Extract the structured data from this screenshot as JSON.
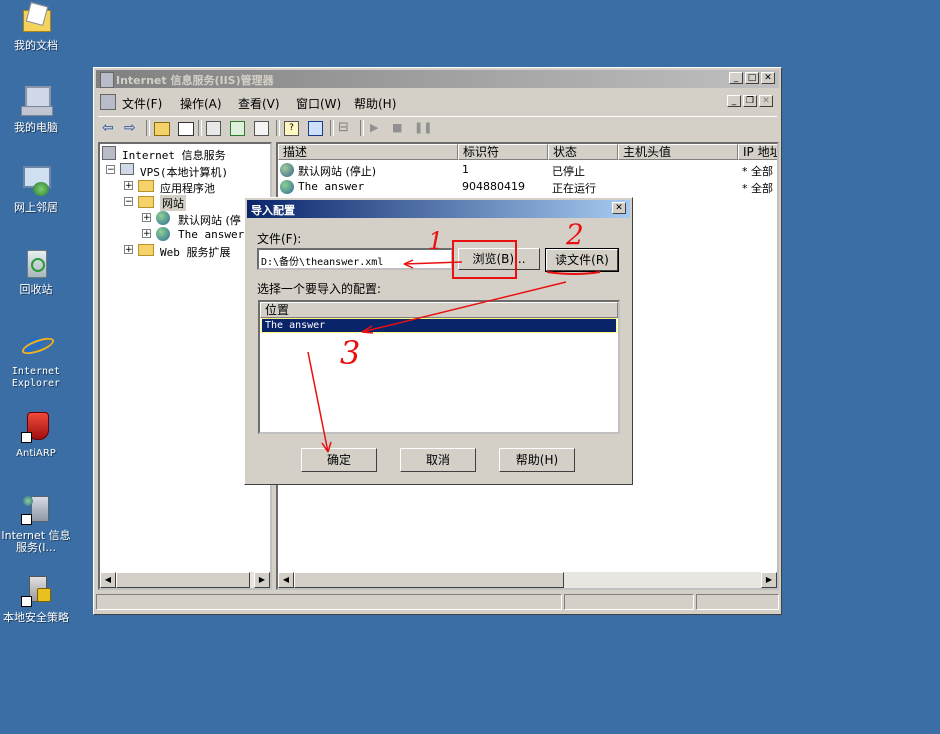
{
  "desktop": {
    "icons": [
      {
        "label": "我的文档",
        "icon": "my-documents-icon"
      },
      {
        "label": "我的电脑",
        "icon": "my-computer-icon"
      },
      {
        "label": "网上邻居",
        "icon": "network-places-icon"
      },
      {
        "label": "回收站",
        "icon": "recycle-bin-icon"
      },
      {
        "label": "Internet Explorer",
        "icon": "ie-icon"
      },
      {
        "label": "AntiARP",
        "icon": "antiarp-shield-icon"
      },
      {
        "label": "Internet 信息服务(I...",
        "icon": "iis-icon"
      },
      {
        "label": "本地安全策略",
        "icon": "local-security-policy-icon"
      }
    ]
  },
  "window": {
    "title": "Internet 信息服务(IIS)管理器",
    "menu": [
      "文件(F)",
      "操作(A)",
      "查看(V)",
      "窗口(W)",
      "帮助(H)"
    ],
    "tree": {
      "root": "Internet 信息服务",
      "computer": "VPS(本地计算机)",
      "app_pools": "应用程序池",
      "websites": "网站",
      "site1": "默认网站 (停",
      "site2": "The answer",
      "web_ext": "Web 服务扩展"
    },
    "list": {
      "columns": [
        "描述",
        "标识符",
        "状态",
        "主机头值",
        "IP 地址"
      ],
      "rows": [
        {
          "desc": "默认网站 (停止)",
          "id": "1",
          "state": "已停止",
          "host": "",
          "ip": "* 全部"
        },
        {
          "desc": "The answer",
          "id": "904880419",
          "state": "正在运行",
          "host": "",
          "ip": "* 全部"
        }
      ]
    }
  },
  "dialog": {
    "title": "导入配置",
    "file_label": "文件(F):",
    "file_value": "D:\\备份\\theanswer.xml",
    "browse_label": "浏览(B)...",
    "read_label": "读文件(R)",
    "select_label": "选择一个要导入的配置:",
    "list_header": "位置",
    "list_items": [
      "The answer"
    ],
    "ok_label": "确定",
    "cancel_label": "取消",
    "help_label": "帮助(H)"
  },
  "annotations": {
    "color": "#e81010",
    "numbers": [
      "1",
      "2",
      "3"
    ]
  }
}
